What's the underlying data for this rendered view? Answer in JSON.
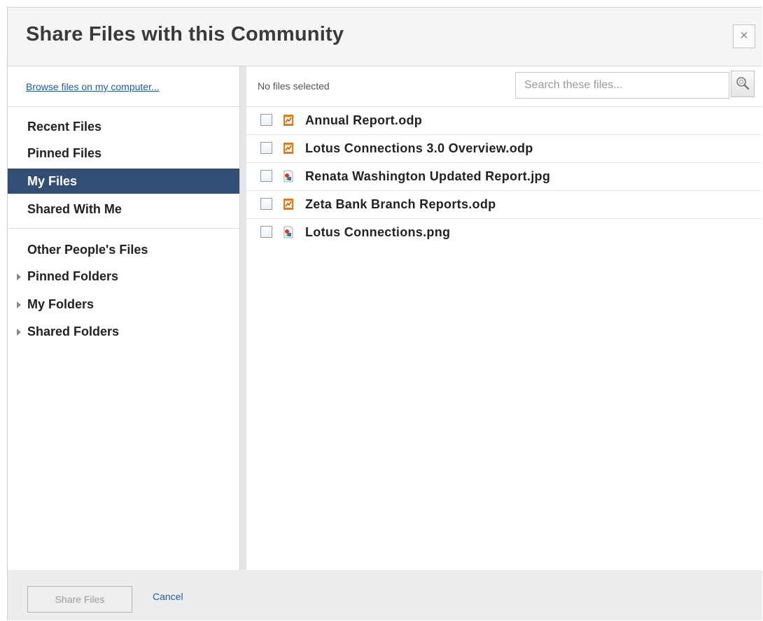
{
  "dialog": {
    "title": "Share Files with this Community",
    "close_label": "×"
  },
  "sidebar": {
    "browse_link": "Browse files on my computer...",
    "nav_items": [
      {
        "label": "Recent Files",
        "selected": false
      },
      {
        "label": "Pinned Files",
        "selected": false
      },
      {
        "label": "My Files",
        "selected": true
      },
      {
        "label": "Shared With Me",
        "selected": false
      }
    ],
    "other_people": "Other People's Files",
    "folders": [
      {
        "label": "Pinned Folders",
        "collapsed": true
      },
      {
        "label": "My Folders",
        "collapsed": true
      },
      {
        "label": "Shared Folders",
        "collapsed": true
      }
    ]
  },
  "toolbar": {
    "status": "No files selected",
    "search_placeholder": "Search these files...",
    "search_value": ""
  },
  "files": [
    {
      "name": "Annual Report.odp",
      "icon": "presentation-icon",
      "checked": false
    },
    {
      "name": "Lotus Connections 3.0 Overview.odp",
      "icon": "presentation-icon",
      "checked": false
    },
    {
      "name": "Renata Washington Updated Report.jpg",
      "icon": "image-icon",
      "checked": false
    },
    {
      "name": "Zeta Bank Branch Reports.odp",
      "icon": "presentation-icon",
      "checked": false
    },
    {
      "name": "Lotus Connections.png",
      "icon": "image-icon",
      "checked": false
    }
  ],
  "footer": {
    "share_label": "Share Files",
    "share_enabled": false,
    "cancel_label": "Cancel"
  },
  "colors": {
    "selected_bg": "#334e74",
    "link": "#1f5a9e",
    "presentation_icon": "#e07b1c"
  }
}
